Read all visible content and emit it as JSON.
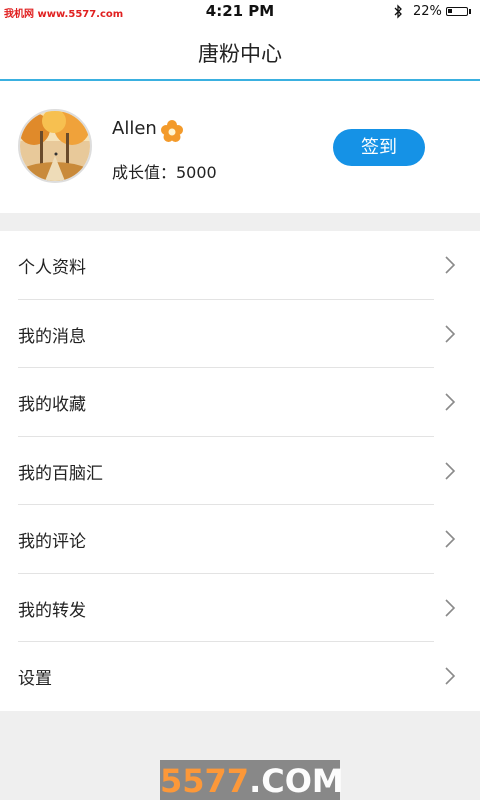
{
  "status_bar": {
    "watermark": "我机网 www.5577.com",
    "time": "4:21 PM",
    "battery_percent": "22%",
    "battery_level": 0.22
  },
  "header": {
    "title": "唐粉中心"
  },
  "profile": {
    "username": "Allen",
    "growth_label": "成长值：5000",
    "checkin_label": "签到",
    "checkin_color": "#1592e6"
  },
  "menu": {
    "items": [
      {
        "label": "个人资料"
      },
      {
        "label": "我的消息"
      },
      {
        "label": "我的收藏"
      },
      {
        "label": "我的百脑汇"
      },
      {
        "label": "我的评论"
      },
      {
        "label": "我的转发"
      },
      {
        "label": "设置"
      }
    ]
  },
  "watermark_bottom": {
    "brand": "5577",
    "suffix": ".COM"
  },
  "accent_color": "#3ab0e0"
}
